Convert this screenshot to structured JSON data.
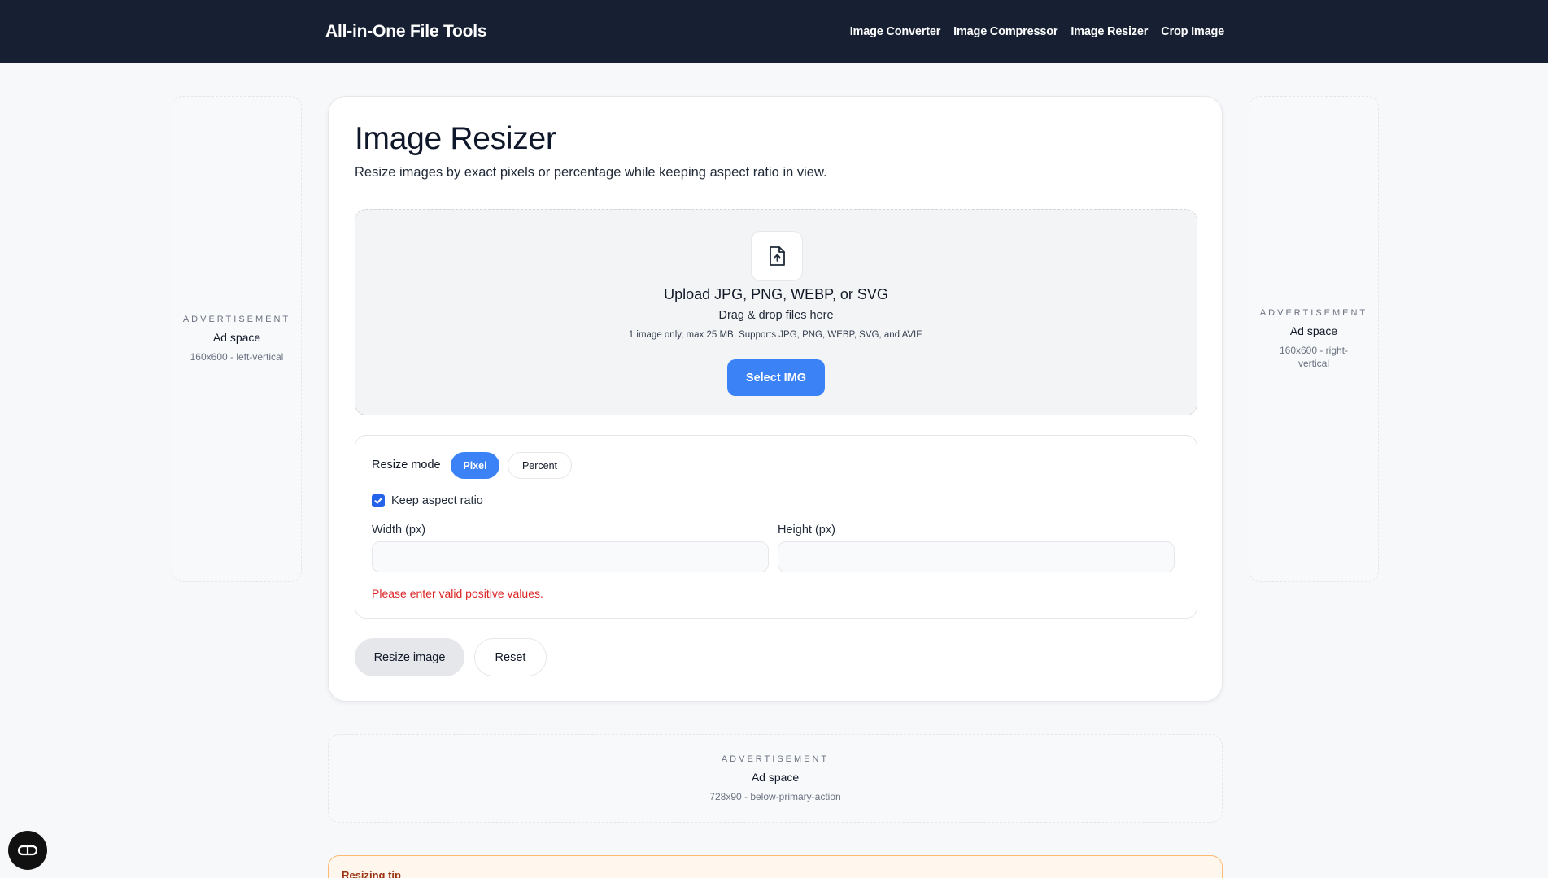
{
  "header": {
    "brand": "All-in-One File Tools",
    "nav": [
      "Image Converter",
      "Image Compressor",
      "Image Resizer",
      "Crop Image"
    ]
  },
  "ads": {
    "left": {
      "kicker": "ADVERTISEMENT",
      "title": "Ad space",
      "size": "160x600 - left-vertical"
    },
    "right": {
      "kicker": "ADVERTISEMENT",
      "title": "Ad space",
      "size": "160x600 - right-vertical"
    },
    "bottom": {
      "kicker": "ADVERTISEMENT",
      "title": "Ad space",
      "size": "728x90 - below-primary-action"
    }
  },
  "main": {
    "title": "Image Resizer",
    "subtitle": "Resize images by exact pixels or percentage while keeping aspect ratio in view.",
    "upload": {
      "icon": "file-upload-icon",
      "title": "Upload JPG, PNG, WEBP, or SVG",
      "drag": "Drag & drop files here",
      "hint": "1 image only, max 25 MB. Supports JPG, PNG, WEBP, SVG, and AVIF.",
      "button": "Select IMG"
    },
    "settings": {
      "mode_label": "Resize mode",
      "modes": [
        "Pixel",
        "Percent"
      ],
      "active_mode": "Pixel",
      "keep_aspect_label": "Keep aspect ratio",
      "keep_aspect_checked": true,
      "width_label": "Width (px)",
      "width_value": "",
      "height_label": "Height (px)",
      "height_value": "",
      "error": "Please enter valid positive values."
    },
    "actions": {
      "resize": "Resize image",
      "reset": "Reset"
    }
  },
  "tip": {
    "title": "Resizing tip"
  },
  "colors": {
    "header_bg": "#172033",
    "accent": "#3b82f6",
    "error": "#dc2626",
    "tip_border": "#fdba74"
  }
}
